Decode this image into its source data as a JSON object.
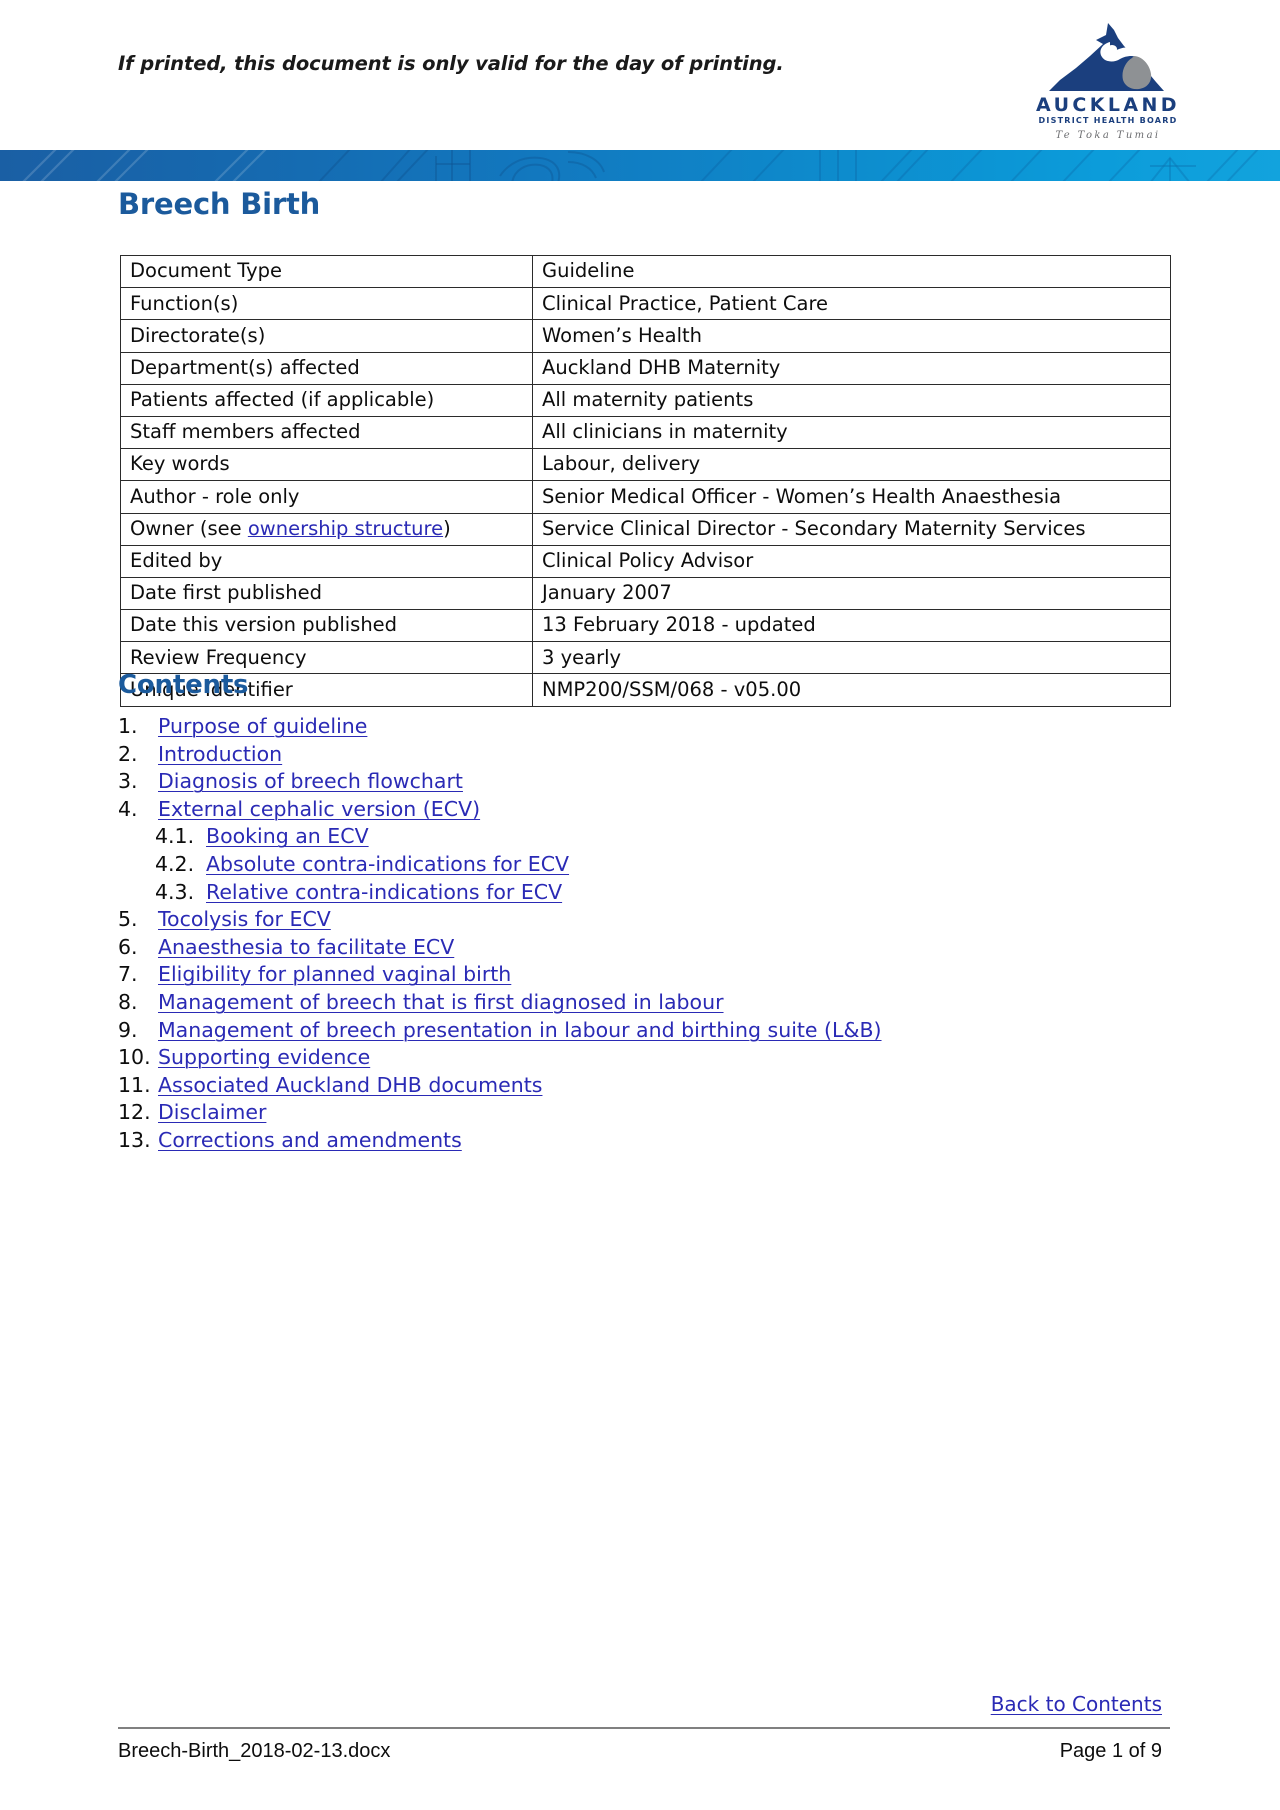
{
  "header": {
    "print_notice": "If printed, this document is only valid for the day of printing.",
    "logo": {
      "wordmark": "AUCKLAND",
      "subtitle": "DISTRICT HEALTH BOARD",
      "tagline": "Te Toka Tumai"
    },
    "band_color_left": "#1a5fa4",
    "band_color_right": "#12a3dd"
  },
  "document": {
    "title": "Breech Birth",
    "title_color": "#1b5a9c"
  },
  "meta_table": {
    "rows": [
      {
        "key": "Document Type",
        "value": "Guideline"
      },
      {
        "key": "Function(s)",
        "value": "Clinical Practice, Patient Care"
      },
      {
        "key": "Directorate(s)",
        "value": "Women’s Health"
      },
      {
        "key": "Department(s) affected",
        "value": "Auckland DHB Maternity"
      },
      {
        "key": "Patients affected (if applicable)",
        "value": "All maternity patients"
      },
      {
        "key": "Staff members affected",
        "value": "All clinicians in maternity"
      },
      {
        "key": "Key words",
        "value": "Labour, delivery"
      },
      {
        "key": "Author - role only",
        "value": "Senior Medical Officer - Women’s Health Anaesthesia"
      },
      {
        "key_prefix": "Owner (see ",
        "key_link": "ownership structure",
        "key_suffix": ")",
        "value": "Service Clinical Director - Secondary Maternity Services"
      },
      {
        "key": "Edited by",
        "value": "Clinical Policy Advisor"
      },
      {
        "key": "Date first published",
        "value": "January 2007"
      },
      {
        "key": "Date this version published",
        "value": "13 February 2018 - updated"
      },
      {
        "key": "Review Frequency",
        "value": "3 yearly"
      },
      {
        "key": "Unique Identifier",
        "value": "NMP200/SSM/068 - v05.00"
      }
    ]
  },
  "contents": {
    "heading": "Contents",
    "link_color": "#2a2ab5",
    "items": [
      {
        "number": "1.",
        "label": "Purpose of guideline",
        "level": 1
      },
      {
        "number": "2.",
        "label": "Introduction",
        "level": 1
      },
      {
        "number": "3.",
        "label": "Diagnosis of breech flowchart",
        "level": 1
      },
      {
        "number": "4.",
        "label": "External cephalic version (ECV)",
        "level": 1
      },
      {
        "number": "4.1.",
        "label": "Booking an ECV",
        "level": 2
      },
      {
        "number": "4.2.",
        "label": "Absolute contra-indications for ECV",
        "level": 2
      },
      {
        "number": "4.3.",
        "label": "Relative contra-indications for ECV",
        "level": 2
      },
      {
        "number": "5.",
        "label": "Tocolysis for ECV",
        "level": 1
      },
      {
        "number": "6.",
        "label": "Anaesthesia to facilitate ECV",
        "level": 1
      },
      {
        "number": "7.",
        "label": "Eligibility for planned vaginal birth",
        "level": 1
      },
      {
        "number": "8.",
        "label": "Management of breech that is first diagnosed in labour",
        "level": 1
      },
      {
        "number": "9.",
        "label": "Management of breech presentation in labour and birthing suite (L&B)",
        "level": 1
      },
      {
        "number": "10.",
        "label": "Supporting evidence",
        "level": 1
      },
      {
        "number": "11.",
        "label": "Associated Auckland DHB documents",
        "level": 1
      },
      {
        "number": "12.",
        "label": "Disclaimer",
        "level": 1
      },
      {
        "number": "13.",
        "label": "Corrections and amendments",
        "level": 1
      }
    ]
  },
  "footer": {
    "back_to_contents": "Back to Contents",
    "filename": "Breech-Birth_2018-02-13.docx",
    "page_indicator": "Page 1 of 9"
  }
}
